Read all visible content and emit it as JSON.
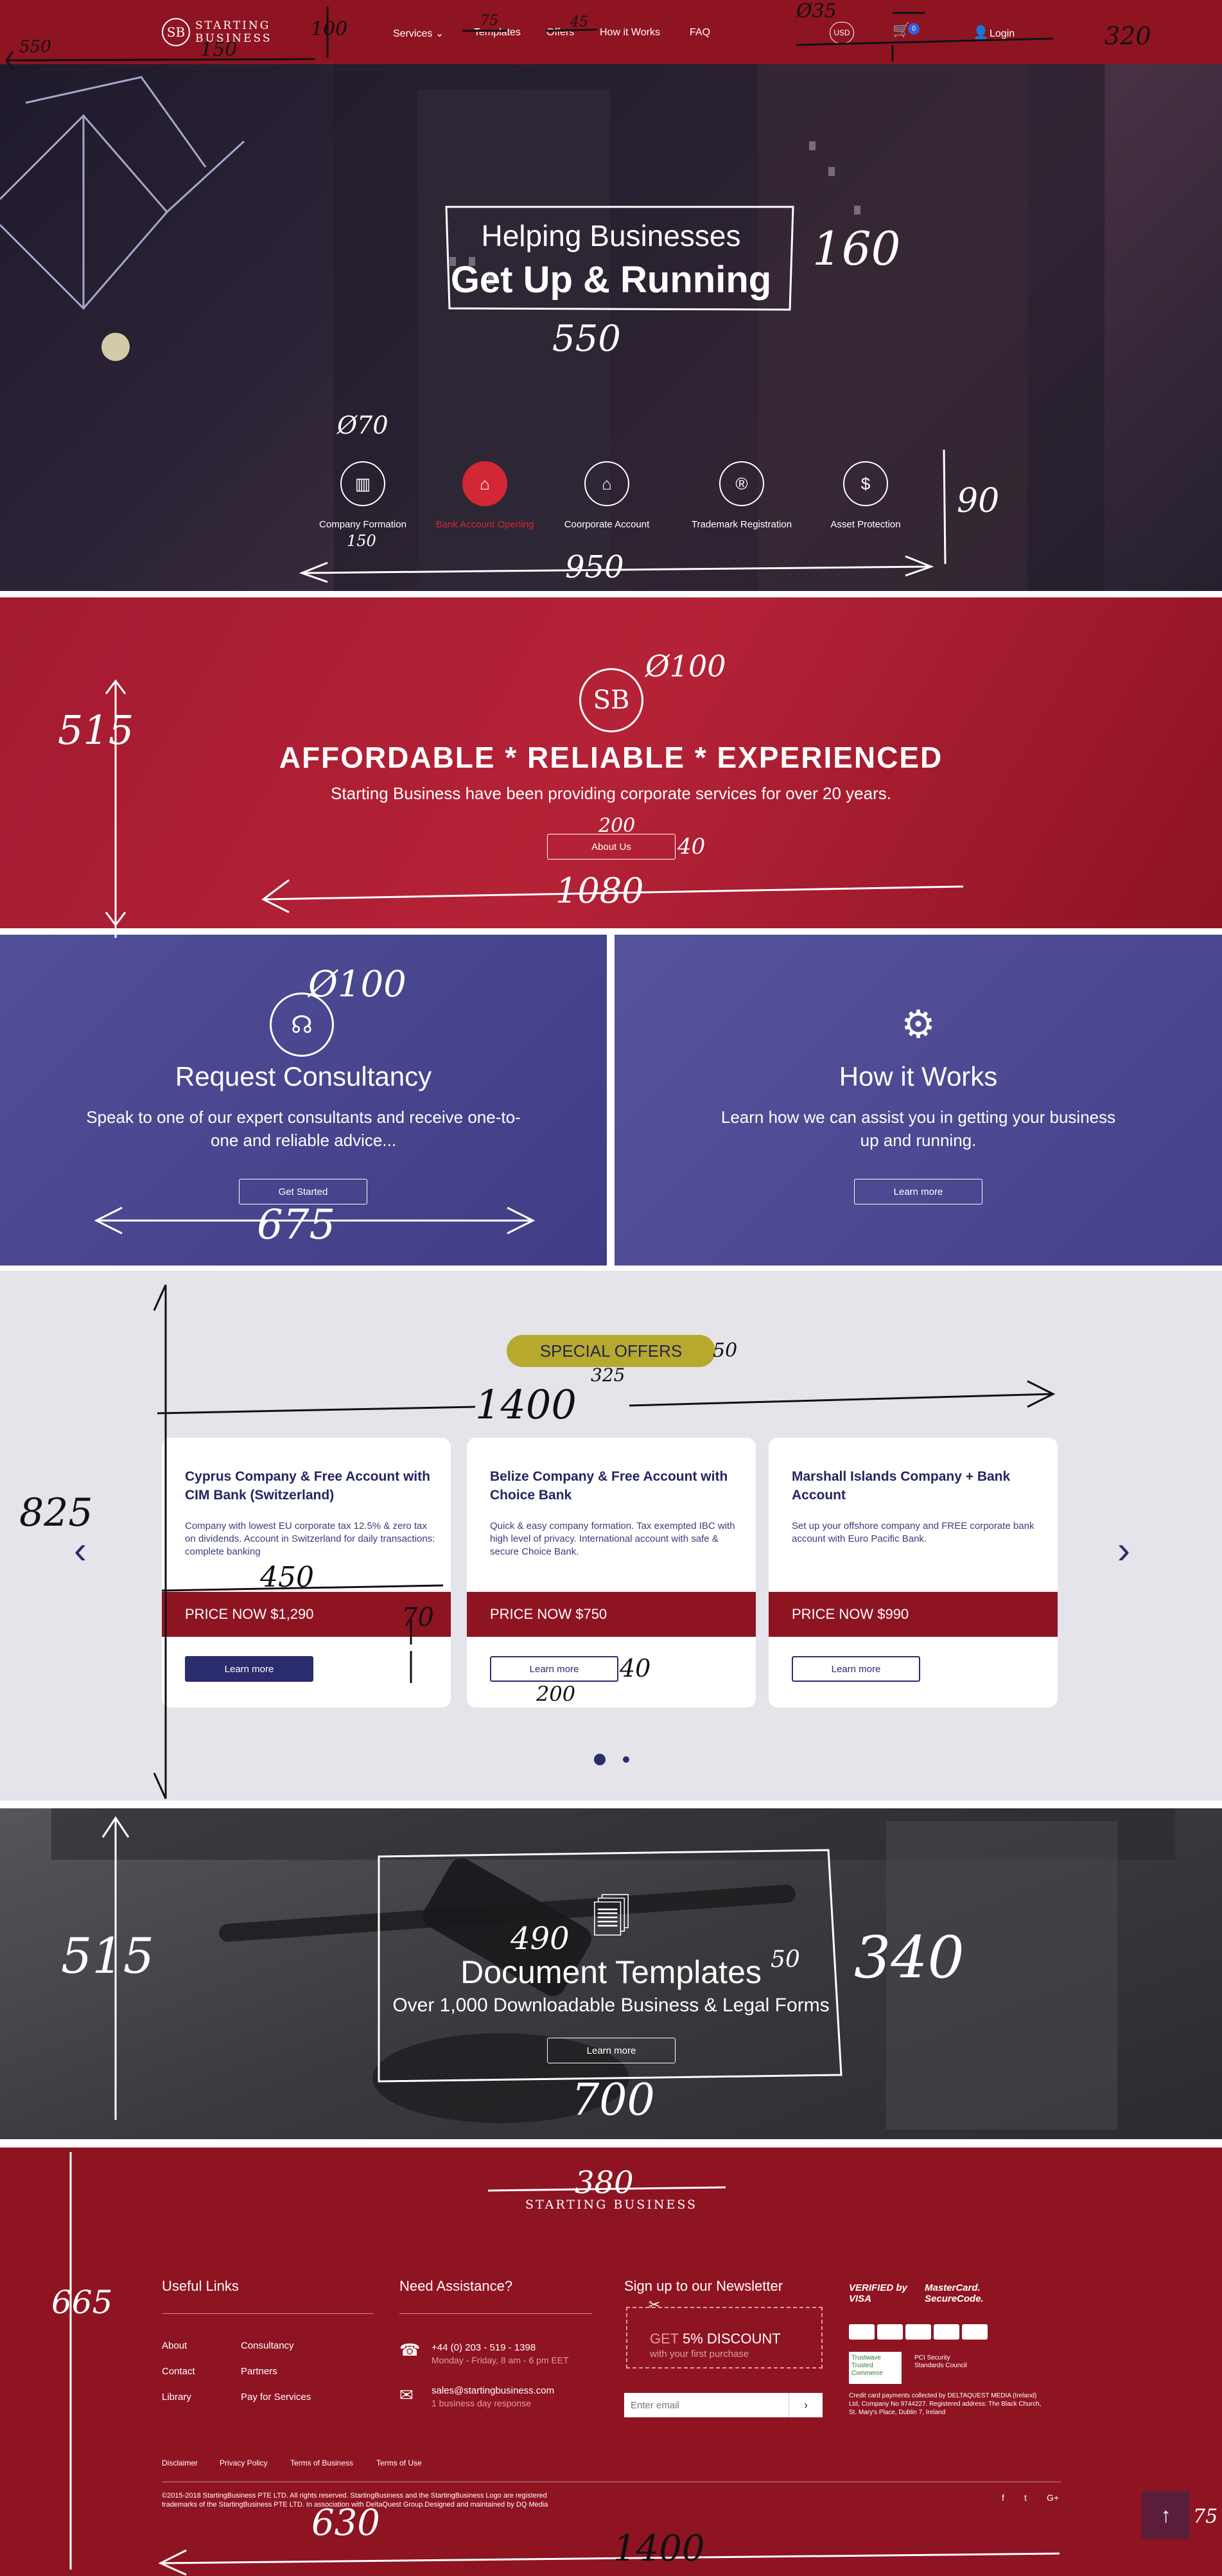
{
  "header": {
    "logo_mark": "SB",
    "logo_line1": "STARTING",
    "logo_line2": "BUSINESS",
    "nav": [
      "Services",
      "Templates",
      "Offers",
      "How it Works",
      "FAQ"
    ],
    "currency": "USD",
    "cart_count": "0",
    "login": "Login"
  },
  "hero": {
    "title_line1": "Helping Businesses",
    "title_line2": "Get Up & Running",
    "services": [
      "Company Formation",
      "Bank Account Opening",
      "Coorporate Account",
      "Trademark Registration",
      "Asset Protection"
    ]
  },
  "afford": {
    "mark": "SB",
    "tagline": "AFFORDABLE  *  RELIABLE  *  EXPERIENCED",
    "subtitle": "Starting Business have been providing corporate services for over 20 years.",
    "button": "About Us"
  },
  "consult": {
    "title": "Request Consultancy",
    "text": "Speak to one of our expert consultants and receive one-to-one and reliable advice...",
    "button": "Get Started"
  },
  "howitworks": {
    "title": "How it Works",
    "text": "Learn how we can assist you in getting your business up and running.",
    "button": "Learn more"
  },
  "offers": {
    "badge": "SPECIAL OFFERS",
    "cards": [
      {
        "title": "Cyprus Company & Free Account with CIM Bank (Switzerland)",
        "desc": "Company with lowest EU corporate tax 12.5% & zero tax on dividends. Account in Switzerland for daily transactions: complete banking",
        "price": "PRICE NOW $1,290",
        "button": "Learn more"
      },
      {
        "title": "Belize Company & Free Account with Choice Bank",
        "desc": "Quick & easy company formation. Tax exempted IBC with high level of privacy. International account with safe & secure Choice Bank.",
        "price": "PRICE NOW $750",
        "button": "Learn more"
      },
      {
        "title": "Marshall Islands Company + Bank Account",
        "desc": "Set up your offshore company and FREE corporate bank account with Euro Pacific Bank.",
        "price": "PRICE NOW $990",
        "button": "Learn more"
      }
    ]
  },
  "templates": {
    "title": "Document Templates",
    "subtitle": "Over 1,000 Downloadable Business & Legal Forms",
    "button": "Learn more"
  },
  "footer": {
    "logo": "STARTING BUSINESS",
    "useful_links_title": "Useful Links",
    "links_col1": [
      "About",
      "Contact",
      "Library"
    ],
    "links_col2": [
      "Consultancy",
      "Partners",
      "Pay for Services"
    ],
    "assist_title": "Need Assistance?",
    "phone": "+44 (0) 203 - 519 - 1398",
    "hours": "Monday - Friday, 8 am - 6 pm EET",
    "email": "sales@startingbusiness.com",
    "response": "1 business day response",
    "newsletter_title": "Sign up to our Newsletter",
    "discount_prefix": "GET",
    "discount": "5% DISCOUNT",
    "discount_sub": "with your first purchase",
    "email_placeholder": "Enter email",
    "badge_visa": "VERIFIED by VISA",
    "badge_mc": "MasterCard. SecureCode.",
    "badge_trustwave": "Trustwave Trusted Commerce",
    "badge_pci": "PCI Security Standards Council",
    "card_note": "Credit card payments collected by DELTAQUEST MEDIA (Ireland) Ltd, Company No 9744227. Registered address: The Black Church, St. Mary's Place, Dublin 7, Ireland",
    "legal_links": [
      "Disclaimer",
      "Privacy Policy",
      "Terms of Business",
      "Terms of Use"
    ],
    "copyright": "©2015-2018 StartingBusiness PTE LTD. All rights reserved. StartingBusiness and the StartingBusiness Logo are registered trademarks of the StartingBusiness PTE LTD. In association with DeltaQuest Group.Designed and maintained by DQ Media",
    "social": [
      "f",
      "t",
      "G+"
    ]
  },
  "annotations": {
    "h100": "100",
    "w550": "550",
    "w150": "150",
    "w75": "75",
    "w45": "45",
    "d35": "Ø35",
    "w320": "320",
    "h160": "160",
    "w550b": "550",
    "d70": "Ø70",
    "w150b": "150",
    "h90": "90",
    "w950": "950",
    "h515": "515",
    "d100": "Ø100",
    "w200": "200",
    "h40": "40",
    "w1080": "1080",
    "d100b": "Ø100",
    "w675": "675",
    "h825": "825",
    "h50": "50",
    "w325": "325",
    "w1400": "1400",
    "w450": "450",
    "h70": "70",
    "h40b": "40",
    "w200b": "200",
    "h515b": "515",
    "w490": "490",
    "h50b": "50",
    "h340": "340",
    "w700": "700",
    "w380": "380",
    "h665": "665",
    "w630": "630",
    "w1400b": "1400",
    "d75": "75"
  }
}
